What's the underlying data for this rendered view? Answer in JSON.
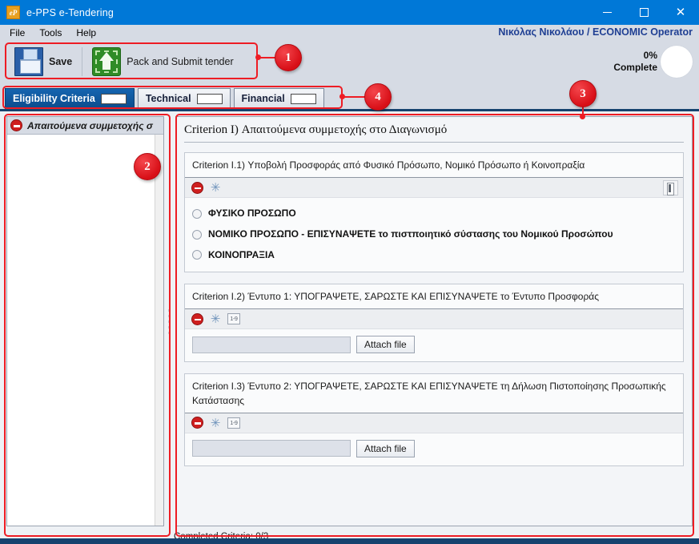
{
  "window": {
    "title": "e-PPS e-Tendering",
    "app_icon": "eP",
    "icon_name": "app-logo-icon",
    "controls": {
      "minimize": "minimize-icon",
      "maximize": "maximize-icon",
      "close": "close-icon"
    },
    "titlebar_color": "#0078d7"
  },
  "menubar": {
    "items": [
      {
        "label": "File"
      },
      {
        "label": "Tools"
      },
      {
        "label": "Help"
      }
    ]
  },
  "user": {
    "label": "Νικόλας Νικολάου / ECONOMIC Operator",
    "color": "#1f3f93"
  },
  "toolbar": {
    "save_label": "Save",
    "save_icon": "floppy-disk-icon",
    "pack_label": "Pack and Submit tender",
    "pack_icon": "upload-box-icon"
  },
  "progress": {
    "percent_label": "0%",
    "complete_label": "Complete",
    "value": 0
  },
  "tabs": [
    {
      "label": "Eligibility Criteria",
      "active": true,
      "badge": ""
    },
    {
      "label": "Technical",
      "active": false,
      "badge": ""
    },
    {
      "label": "Financial",
      "active": false,
      "badge": ""
    }
  ],
  "tree": {
    "header_label": "Απαιτούμενα συμμετοχής σ",
    "header_icon": "no-entry-icon",
    "items": []
  },
  "criterion": {
    "title": "Criterion I) Απαιτούμενα συμμετοχής στο Διαγωνισμό",
    "cards": [
      {
        "head": "Criterion I.1) Υποβολή Προσφοράς από Φυσικό Πρόσωπο, Νομικό Πρόσωπο ή Κοινοπραξία",
        "tools": [
          "no-entry-icon",
          "asterisk-required-icon"
        ],
        "has_attach_doc_icon": true,
        "type": "radio",
        "options": [
          {
            "label": "ΦΥΣΙΚΟ ΠΡΟΣΩΠΟ",
            "selected": false
          },
          {
            "label": "ΝΟΜΙΚΟ ΠΡΟΣΩΠΟ - ΕΠΙΣΥΝΑΨΕΤΕ το πιστποιητικό σύστασης του Νομικού Προσώπου",
            "selected": false
          },
          {
            "label": "ΚΟΙΝΟΠΡΑΞΙΑ",
            "selected": false
          }
        ]
      },
      {
        "head": "Criterion I.2) Έντυπο 1: ΥΠΟΓΡΑΨΕΤΕ, ΣΑΡΩΣΤΕ ΚΑΙ ΕΠΙΣΥΝΑΨΕΤΕ το Έντυπο Προσφοράς",
        "tools": [
          "no-entry-icon",
          "asterisk-required-icon",
          "number-range-icon"
        ],
        "number_range_label": "1-9",
        "has_attach_doc_icon": false,
        "type": "attach",
        "file_value": "",
        "file_placeholder": "",
        "attach_label": "Attach file"
      },
      {
        "head": "Criterion I.3) Έντυπο 2: ΥΠΟΓΡΑΨΕΤΕ, ΣΑΡΩΣΤΕ ΚΑΙ ΕΠΙΣΥΝΑΨΕΤΕ τη Δήλωση Πιστοποίησης Προσωπικής Κατάστασης",
        "tools": [
          "no-entry-icon",
          "asterisk-required-icon",
          "number-range-icon"
        ],
        "number_range_label": "1-9",
        "has_attach_doc_icon": false,
        "type": "attach",
        "file_value": "",
        "file_placeholder": "",
        "attach_label": "Attach file"
      }
    ]
  },
  "statusbar": {
    "label": "Completed Criteria: 0/3"
  },
  "annotations": {
    "color": "#ee1c24",
    "markers": [
      {
        "number": "1",
        "target": "toolbar-region"
      },
      {
        "number": "2",
        "target": "tree-panel-region"
      },
      {
        "number": "3",
        "target": "criterion-panel-region"
      },
      {
        "number": "4",
        "target": "tabstrip-region"
      }
    ]
  }
}
